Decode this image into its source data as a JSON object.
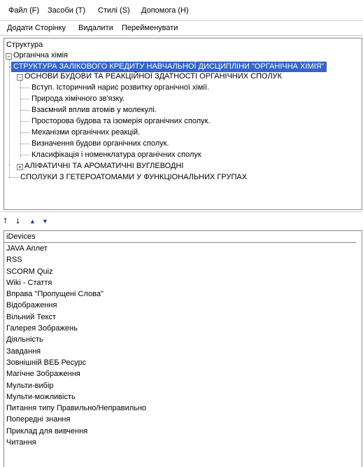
{
  "menu": [
    {
      "label": "Файл (F)"
    },
    {
      "label": "Засоби (T)"
    },
    {
      "label": "Стилі (S)"
    },
    {
      "label": "Допомога (H)"
    }
  ],
  "toolbar": {
    "add_page": "Додати Сторінку",
    "delete": "Видалити",
    "rename": "Перейменувати"
  },
  "structure": {
    "title": "Структура",
    "root": "Органічна хімія",
    "nodes": [
      "СТРУКТУРА ЗАЛІКОВОГО КРЕДИТУ НАВЧАЛЬНОЇ ДИСЦИПЛІНИ \"ОРГАНІЧНА ХІМІЯ\"",
      "ОСНОВИ БУДОВИ ТА РЕАКЦІЙНОЇ ЗДАТНОСТІ ОРГАНІЧНИХ СПОЛУК",
      "Вступ. Історичний нарис розвитку органічної хімії.",
      "Природа хімічного зв'язку.",
      "Взаємний вплив атомів у молекулі.",
      "Просторова будова та ізомерія органічних сполук.",
      "Механізми органічних реакцій.",
      "Визначення будови органічних сполук.",
      "Класифікація і номенклатура органічних сполук",
      "АЛІФАТИЧНІ ТА АРОМАТИЧНІ ВУГЛЕВОДНІ",
      "СПОЛУКИ З ГЕТЕРОАТОМАМИ У ФУНКЦІОНАЛЬНИХ ГРУПАХ"
    ]
  },
  "arrows": [
    "⭡",
    "⭣",
    "▲",
    "▼"
  ],
  "idevices": {
    "title": "iDevices",
    "items": [
      "JAVA Аплет",
      "RSS",
      "SCORM Quiz",
      "Wiki - Стаття",
      "Вправа \"Пропущені Слова\"",
      "Відображення",
      "Вільний Текст",
      "Галерея Зображень",
      "Діяльність",
      "Завдання",
      "Зовнішній ВЕБ Ресурс",
      "Магічне Зображення",
      "Мульти-вибір",
      "Мульти-можливість",
      "Питання типу Правильно/Неправильно",
      "Попередні знання",
      "Приклад для вивчення",
      "Читання"
    ]
  },
  "colors": {
    "selection": "#3465c9",
    "arrow": "#1f3f8a"
  }
}
